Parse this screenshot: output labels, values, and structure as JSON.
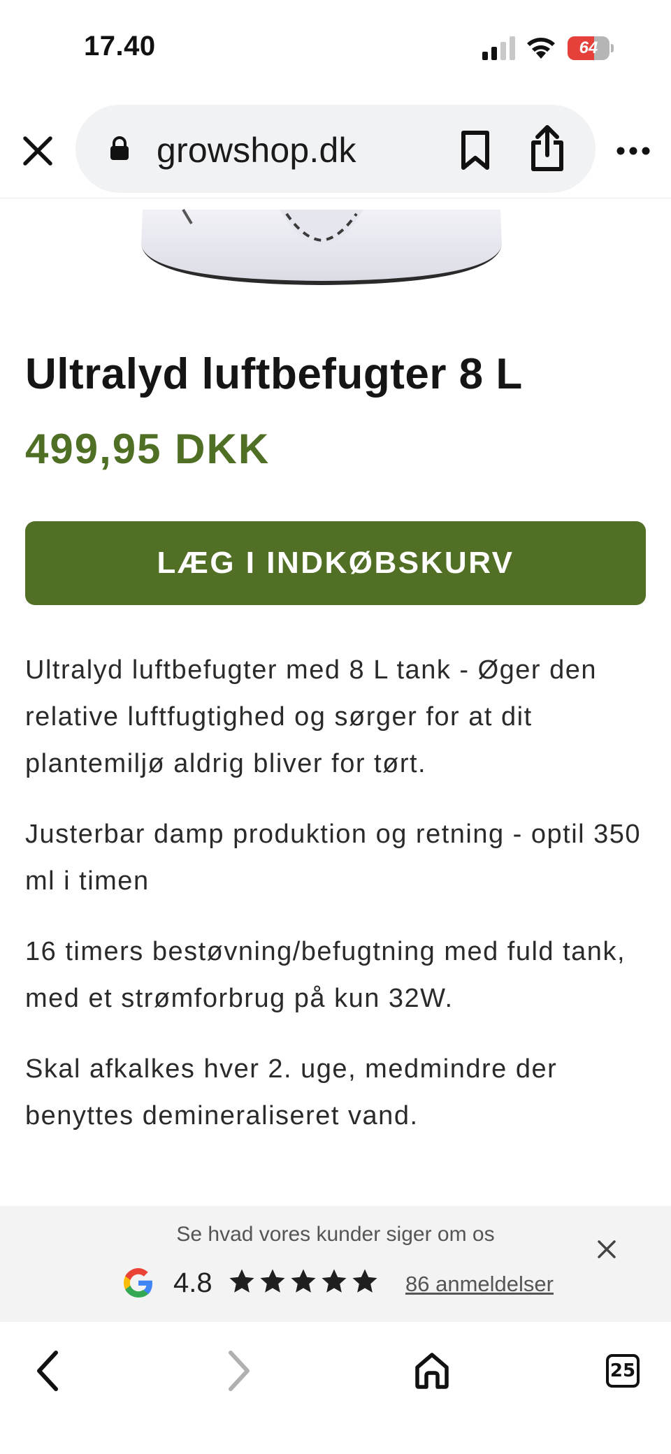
{
  "status_bar": {
    "time": "17.40",
    "battery_percent": 64,
    "battery_label": "64",
    "icons": [
      "signal-icon",
      "wifi-icon",
      "battery-icon"
    ]
  },
  "browser": {
    "url": "growshop.dk",
    "icons": [
      "close-icon",
      "lock-icon",
      "bookmark-icon",
      "share-icon",
      "more-icon"
    ]
  },
  "product": {
    "title": "Ultralyd luftbefugter 8 L",
    "price": "499,95 DKK",
    "add_to_cart_label": "LÆG I INDKØBSKURV",
    "description": [
      "Ultralyd luftbefugter med 8 L tank - Øger den relative luftfugtighed og sørger for at dit plantemiljø aldrig bliver for tørt.",
      "Justerbar damp produktion og retning - optil 350 ml i timen",
      "16 timers bestøvning/befugtning med fuld tank, med et strømforbrug på kun 32W.",
      "Skal afkalkes hver 2. uge, medmindre der benyttes demineraliseret vand."
    ]
  },
  "reviews": {
    "heading": "Se hvad vores kunder siger om os",
    "rating": "4.8",
    "stars_filled": 5,
    "stars_total": 5,
    "reviews_link": "86 anmeldelser"
  },
  "toolbar": {
    "tabs_count": "25",
    "icons": [
      "back-icon",
      "forward-icon",
      "home-icon",
      "tabs-icon"
    ]
  },
  "colors": {
    "accent_green": "#526f26",
    "price_green": "#4f6f24",
    "battery_low": "#e5413a"
  }
}
